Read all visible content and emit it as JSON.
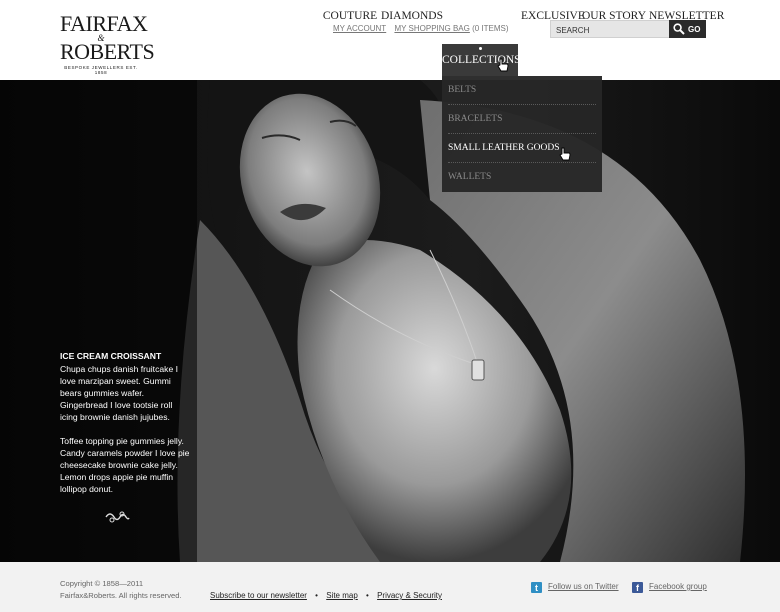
{
  "brand": {
    "line1": "FAIRFAX",
    "amp": "&",
    "line2": "ROBERTS",
    "tagline": "BESPOKE JEWELLERS EST. 1858"
  },
  "utility": {
    "account": "MY ACCOUNT",
    "bag": "MY SHOPPING BAG",
    "bag_count": "(0 ITEMS)"
  },
  "search": {
    "placeholder": "SEARCH",
    "button": "GO"
  },
  "nav": {
    "items": [
      "COUTURE",
      "DIAMONDS",
      "COLLECTIONS",
      "EXCLUSIVE",
      "OUR STORY",
      "NEWSLETTER"
    ],
    "active": "COLLECTIONS"
  },
  "dropdown": {
    "items": [
      "BELTS",
      "BRACELETS",
      "SMALL LEATHER GOODS",
      "WALLETS"
    ],
    "hovered": "SMALL LEATHER GOODS"
  },
  "hero": {
    "heading": "ICE CREAM CROISSANT",
    "para1": "Chupa chups danish fruitcake I love marzipan sweet. Gummi bears gummies wafer. Gingerbread I love tootsie roll icing brownie danish jujubes.",
    "para2": "Toffee topping pie gummies jelly. Candy caramels powder I love pie cheesecake brownie cake jelly. Lemon drops appie pie muffin lollipop donut."
  },
  "footer": {
    "copyright": "Copyright © 1858—2011",
    "rights": "Fairfax&Roberts. All rights reserved.",
    "links": [
      "Subscribe to our newsletter",
      "Site map",
      "Privacy & Security"
    ],
    "separator": "•",
    "twitter": "Follow us on Twitter",
    "facebook": "Facebook group"
  },
  "colors": {
    "nav_active_bg": "#3a3a3a",
    "dropdown_bg": "#262626",
    "footer_bg": "#f2f2f2",
    "twitter": "#2f8fc4",
    "facebook": "#3b5998"
  }
}
